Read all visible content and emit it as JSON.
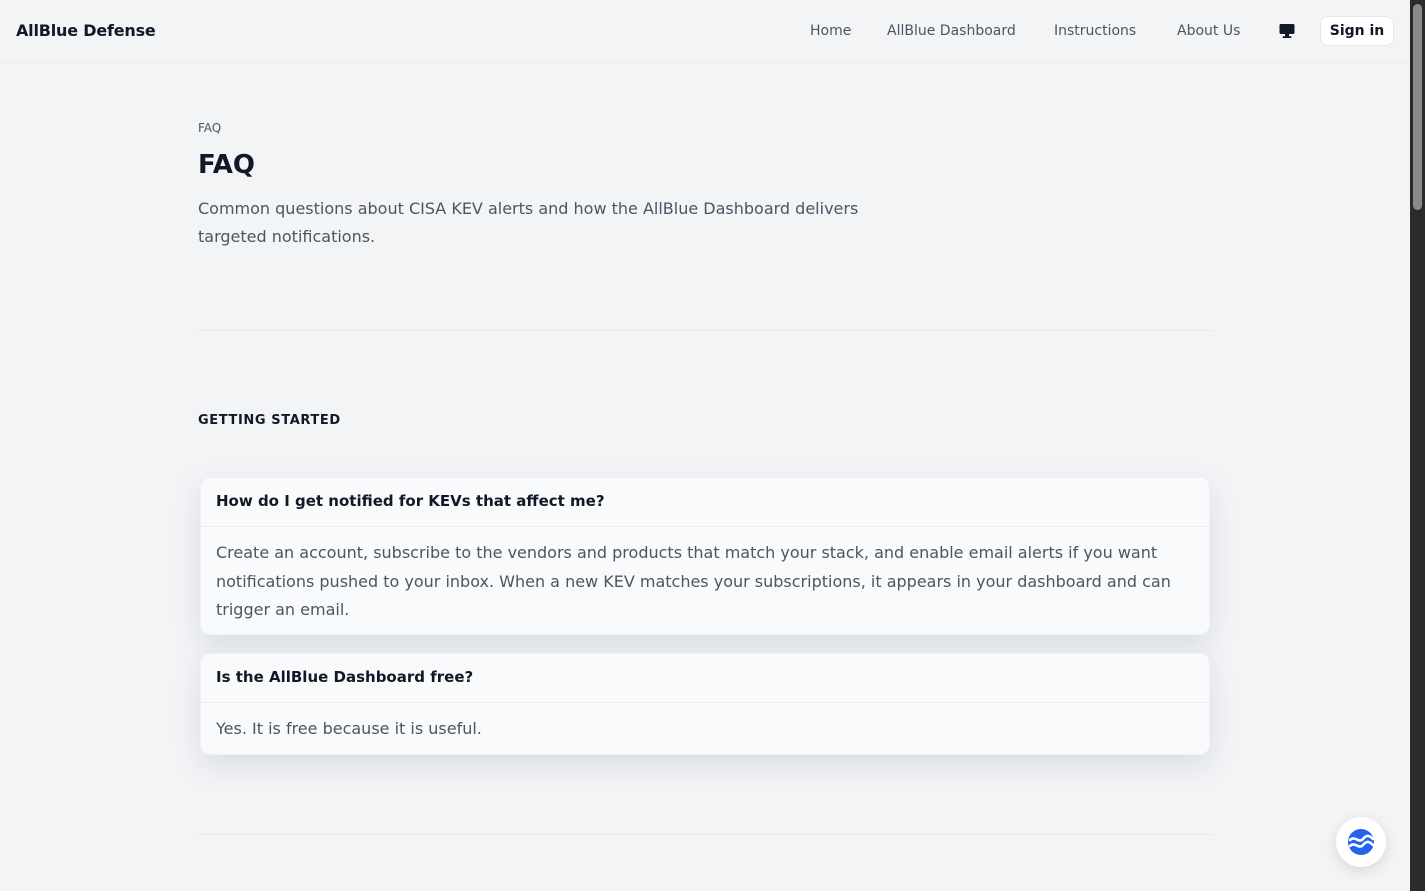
{
  "header": {
    "brand": "AllBlue Defense",
    "nav": [
      "Home",
      "AllBlue Dashboard",
      "Instructions",
      "About Us"
    ],
    "theme_icon": "monitor-icon",
    "signin_label": "Sign in"
  },
  "hero": {
    "breadcrumb": "FAQ",
    "title": "FAQ",
    "subtitle": "Common questions about CISA KEV alerts and how the AllBlue Dashboard delivers targeted notifications."
  },
  "section": {
    "title": "GETTING STARTED"
  },
  "faqs": [
    {
      "question": "How do I get notified for KEVs that affect me?",
      "answer": "Create an account, subscribe to the vendors and products that match your stack, and enable email alerts if you want notifications pushed to your inbox. When a new KEV matches your subscriptions, it appears in your dashboard and can trigger an email."
    },
    {
      "question": "Is the AllBlue Dashboard free?",
      "answer": "Yes. It is free because it is useful."
    }
  ],
  "chat": {
    "icon": "chat-assistant-icon",
    "accent": "#2563eb"
  }
}
